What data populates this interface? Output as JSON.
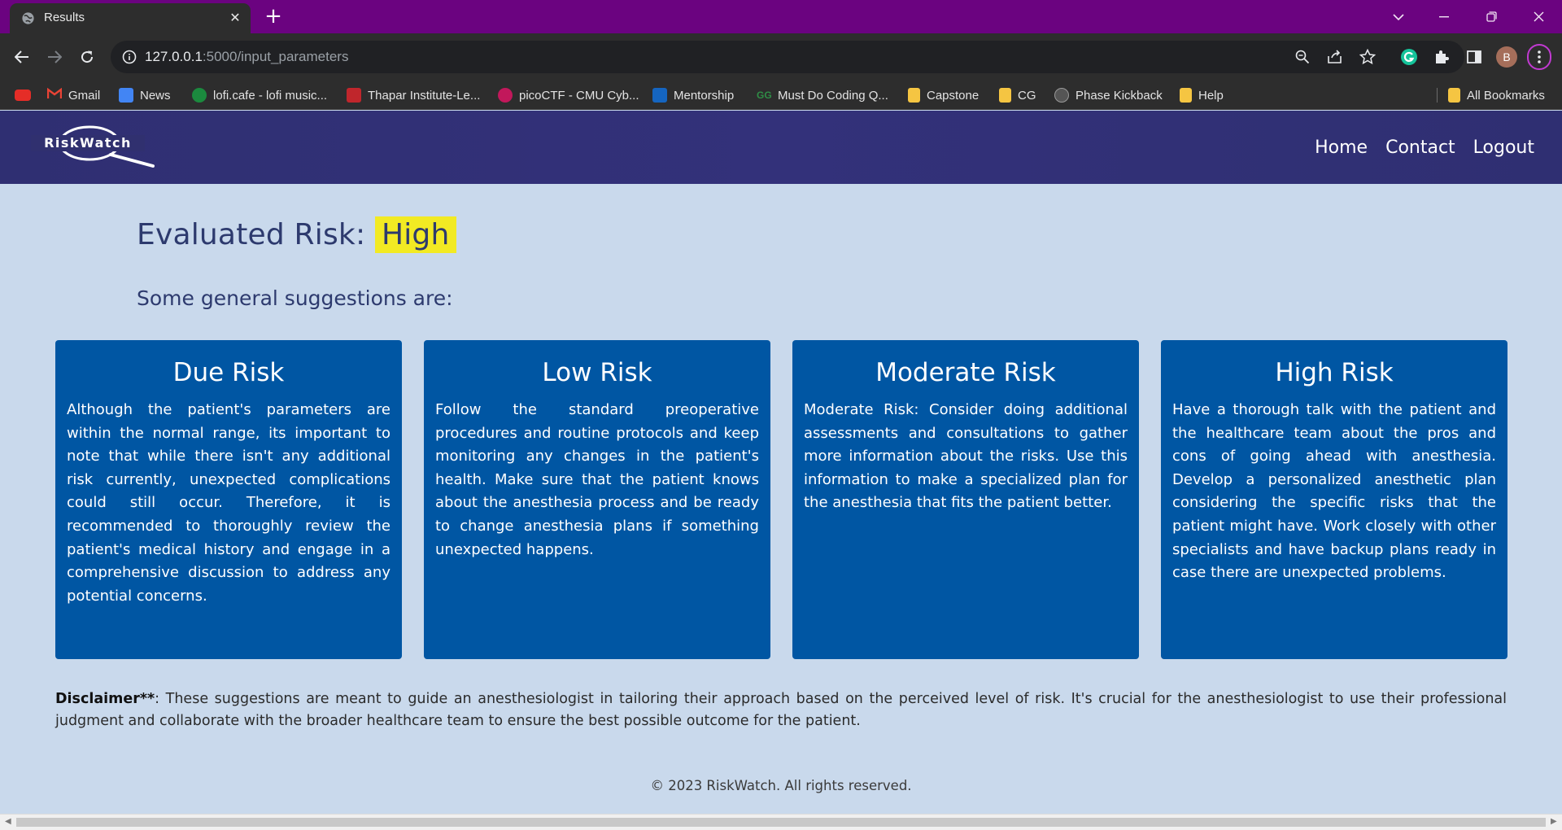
{
  "browser": {
    "tab_title": "Results",
    "url_host": "127.0.0.1",
    "url_path": ":5000/input_parameters",
    "profile_initial": "B",
    "bookmarks": [
      {
        "label": "",
        "icon": "youtube-icon",
        "color": "#e52d27"
      },
      {
        "label": "Gmail",
        "icon": "gmail-icon",
        "color": "#ea4335"
      },
      {
        "label": "News",
        "icon": "news-icon",
        "color": "#4285f4"
      },
      {
        "label": "lofi.cafe - lofi music...",
        "icon": "lofi-icon",
        "color": "#1b8a3e"
      },
      {
        "label": "Thapar Institute-Le...",
        "icon": "thapar-icon",
        "color": "#c0262c"
      },
      {
        "label": "picoCTF - CMU Cyb...",
        "icon": "picoctf-icon",
        "color": "#c2185b"
      },
      {
        "label": "Mentorship",
        "icon": "mentorship-icon",
        "color": "#1565c0"
      },
      {
        "label": "Must Do Coding Q...",
        "icon": "gfg-icon",
        "color": "#2f8d46"
      },
      {
        "label": "Capstone",
        "icon": "folder-icon",
        "color": "#f5c542"
      },
      {
        "label": "CG",
        "icon": "folder-icon",
        "color": "#f5c542"
      },
      {
        "label": "Phase Kickback",
        "icon": "globe-icon",
        "color": "#555555"
      },
      {
        "label": "Help",
        "icon": "folder-icon",
        "color": "#f5c542"
      }
    ],
    "all_bookmarks": "All Bookmarks"
  },
  "nav": {
    "logo_text": "RiskWatch",
    "links": [
      "Home",
      "Contact",
      "Logout"
    ]
  },
  "result": {
    "heading_prefix": "Evaluated Risk:",
    "level": "High",
    "level_color": "#f2ea23",
    "subheading": "Some general suggestions are:"
  },
  "cards": [
    {
      "title": "Due Risk",
      "text": "Although the patient's parameters are within the normal range, its important to note that while there isn't any additional risk currently, unexpected complications could still occur. Therefore, it is recommended to thoroughly review the patient's medical history and engage in a comprehensive discussion to address any potential concerns."
    },
    {
      "title": "Low Risk",
      "text": "Follow the standard preoperative procedures and routine protocols and keep monitoring any changes in the patient's health. Make sure that the patient knows about the anesthesia process and be ready to change anesthesia plans if something unexpected happens."
    },
    {
      "title": "Moderate Risk",
      "text": "Moderate Risk: Consider doing additional assessments and consultations to gather more information about the risks. Use this information to make a specialized plan for the anesthesia that fits the patient better."
    },
    {
      "title": "High Risk",
      "text": "Have a thorough talk with the patient and the healthcare team about the pros and cons of going ahead with anesthesia. Develop a personalized anesthetic plan considering the specific risks that the patient might have. Work closely with other specialists and have backup plans ready in case there are unexpected problems."
    }
  ],
  "disclaimer": {
    "label": "Disclaimer**",
    "text": ": These suggestions are meant to guide an anesthesiologist in tailoring their approach based on the perceived level of risk. It's crucial for the anesthesiologist to use their professional judgment and collaborate with the broader healthcare team to ensure the best possible outcome for the patient."
  },
  "footer": "© 2023 RiskWatch. All rights reserved.",
  "colors": {
    "navbar": "#2f2f72",
    "card": "#0056a3",
    "page_bg": "#c9d9ec",
    "heading": "#2d3a6e"
  }
}
